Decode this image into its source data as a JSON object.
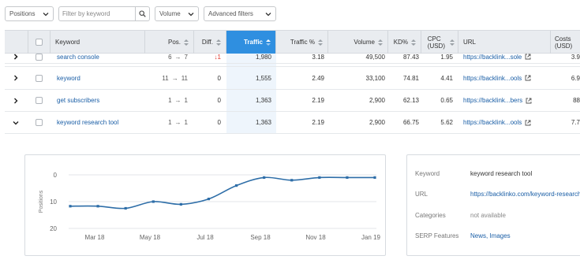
{
  "filters": {
    "positions_label": "Positions",
    "search_placeholder": "Filter by keyword",
    "volume_label": "Volume",
    "advanced_label": "Advanced filters"
  },
  "columns": {
    "keyword": "Keyword",
    "pos": "Pos.",
    "diff": "Diff.",
    "traffic": "Traffic",
    "traffic_pct": "Traffic %",
    "volume": "Volume",
    "kd": "KD%",
    "cpc_line1": "CPC",
    "cpc_line2": "(USD)",
    "url": "URL",
    "costs_line1": "Costs",
    "costs_line2": "(USD)"
  },
  "rows": [
    {
      "keyword": "search console",
      "pos_from": "6",
      "pos_to": "7",
      "diff": "1",
      "diff_dir": "down",
      "traffic": "1,980",
      "traffic_pct": "3.18",
      "volume": "49,500",
      "kd": "87.43",
      "cpc": "1.95",
      "url": "https://backlink...sole",
      "costs": "3.9"
    },
    {
      "keyword": "keyword",
      "pos_from": "11",
      "pos_to": "11",
      "diff": "0",
      "diff_dir": "none",
      "traffic": "1,555",
      "traffic_pct": "2.49",
      "volume": "33,100",
      "kd": "74.81",
      "cpc": "4.41",
      "url": "https://backlink...ools",
      "costs": "6.9"
    },
    {
      "keyword": "get subscribers",
      "pos_from": "1",
      "pos_to": "1",
      "diff": "0",
      "diff_dir": "none",
      "traffic": "1,363",
      "traffic_pct": "2.19",
      "volume": "2,900",
      "kd": "62.13",
      "cpc": "0.65",
      "url": "https://backlink...bers",
      "costs": "88"
    },
    {
      "keyword": "keyword research tool",
      "pos_from": "1",
      "pos_to": "1",
      "diff": "0",
      "diff_dir": "none",
      "traffic": "1,363",
      "traffic_pct": "2.19",
      "volume": "2,900",
      "kd": "66.75",
      "cpc": "5.62",
      "url": "https://backlink...ools",
      "costs": "7.7"
    }
  ],
  "chart_data": {
    "type": "line",
    "title": "",
    "xlabel": "",
    "ylabel": "Positions",
    "ylim": [
      0,
      20
    ],
    "y_inverted": true,
    "y_ticks": [
      "0",
      "10",
      "20"
    ],
    "x_ticks": [
      "Mar 18",
      "May 18",
      "Jul 18",
      "Sep 18",
      "Nov 18",
      "Jan 19"
    ],
    "series": [
      {
        "values": [
          11.7,
          11.7,
          12.5,
          10,
          11,
          9,
          4,
          1,
          2,
          1,
          1,
          1
        ]
      }
    ],
    "color": "#2e6ea8",
    "grid": true
  },
  "details": {
    "keyword_label": "Keyword",
    "keyword_value": "keyword research tool",
    "url_label": "URL",
    "url_value": "https://backlinko.com/keyword-research-tools",
    "categories_label": "Categories",
    "categories_value": "not available",
    "serp_label": "SERP Features",
    "serp_value": "News, Images"
  },
  "colors": {
    "accent": "#2f8fe0",
    "link": "#1a5ea6",
    "header_bg": "#e9ecf0",
    "down": "#e0352b"
  }
}
